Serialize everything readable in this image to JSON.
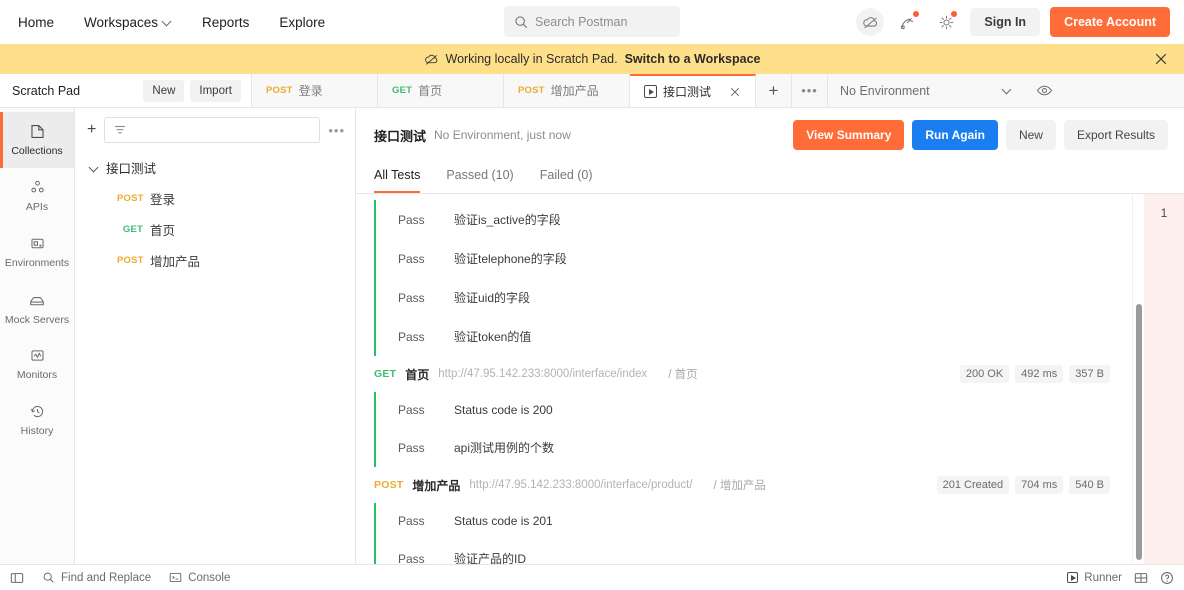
{
  "topbar": {
    "nav": [
      {
        "label": "Home",
        "icon": null
      },
      {
        "label": "Workspaces",
        "icon": "chevron-down-icon"
      },
      {
        "label": "Reports",
        "icon": null
      },
      {
        "label": "Explore",
        "icon": null
      }
    ],
    "search_placeholder": "Search Postman",
    "search_icon": "search-icon",
    "cloud_icon": "cloud-offline-icon",
    "notifications_icon": "satellite-notification-icon",
    "settings_icon": "gear-icon",
    "sign_in_label": "Sign In",
    "create_account_label": "Create Account",
    "accent": "#ff6c37"
  },
  "banner": {
    "icon": "cloud-offline-icon",
    "text": "Working locally in Scratch Pad.",
    "link": "Switch to a Workspace",
    "close_icon": "close-icon",
    "background": "#ffe08a"
  },
  "workspace": {
    "name": "Scratch Pad",
    "new_label": "New",
    "import_label": "Import"
  },
  "tabs": [
    {
      "method": "POST",
      "name": "登录",
      "active": false,
      "icon": null
    },
    {
      "method": "GET",
      "name": "首页",
      "active": false,
      "icon": null
    },
    {
      "method": "POST",
      "name": "增加产品",
      "active": false,
      "icon": null
    },
    {
      "method": null,
      "name": "接口测试",
      "active": true,
      "icon": "runner-play-icon"
    }
  ],
  "tabbar": {
    "plus_icon": "plus-icon",
    "more_icon": "ellipsis-icon",
    "environment_selected": "No Environment",
    "environment_chevron": "chevron-down-icon",
    "eye_icon": "eye-icon"
  },
  "rail": [
    {
      "label": "Collections",
      "icon": "collections-icon",
      "active": true
    },
    {
      "label": "APIs",
      "icon": "apis-icon",
      "active": false
    },
    {
      "label": "Environments",
      "icon": "environments-icon",
      "active": false
    },
    {
      "label": "Mock Servers",
      "icon": "mock-servers-icon",
      "active": false
    },
    {
      "label": "Monitors",
      "icon": "monitors-icon",
      "active": false
    },
    {
      "label": "History",
      "icon": "history-icon",
      "active": false
    }
  ],
  "sidebar": {
    "plus_icon": "plus-icon",
    "filter_icon": "filter-icon",
    "filter_placeholder": "",
    "more_icon": "ellipsis-icon",
    "collection": {
      "name": "接口测试",
      "chevron_icon": "chevron-down-icon",
      "requests": [
        {
          "method": "POST",
          "name": "登录"
        },
        {
          "method": "GET",
          "name": "首页"
        },
        {
          "method": "POST",
          "name": "增加产品"
        }
      ]
    }
  },
  "runner": {
    "title": "接口测试",
    "subtitle": "No Environment, just now",
    "buttons": {
      "view_summary": "View Summary",
      "run_again": "Run Again",
      "new": "New",
      "export_results": "Export Results"
    },
    "result_tabs": [
      {
        "label": "All Tests",
        "active": true
      },
      {
        "label": "Passed (10)",
        "active": false
      },
      {
        "label": "Failed (0)",
        "active": false
      }
    ],
    "side_badge": "1",
    "blocks": [
      {
        "request": null,
        "tests": [
          {
            "status": "Pass",
            "name": "验证is_active的字段"
          },
          {
            "status": "Pass",
            "name": "验证telephone的字段"
          },
          {
            "status": "Pass",
            "name": "验证uid的字段"
          },
          {
            "status": "Pass",
            "name": "验证token的值"
          }
        ]
      },
      {
        "request": {
          "method": "GET",
          "name": "首页",
          "url": "http://47.95.142.233:8000/interface/index",
          "path": "/ 首页",
          "status": "200 OK",
          "time": "492 ms",
          "size": "357 B"
        },
        "tests": [
          {
            "status": "Pass",
            "name": "Status code is 200"
          },
          {
            "status": "Pass",
            "name": "api测试用例的个数"
          }
        ]
      },
      {
        "request": {
          "method": "POST",
          "name": "增加产品",
          "url": "http://47.95.142.233:8000/interface/product/",
          "path": "/ 增加产品",
          "status": "201 Created",
          "time": "704 ms",
          "size": "540 B"
        },
        "tests": [
          {
            "status": "Pass",
            "name": "Status code is 201"
          },
          {
            "status": "Pass",
            "name": "验证产品的ID"
          }
        ]
      }
    ]
  },
  "footer": {
    "sidebar_toggle_icon": "sidebar-toggle-icon",
    "find_replace_label": "Find and Replace",
    "find_replace_icon": "search-icon",
    "console_label": "Console",
    "console_icon": "console-icon",
    "runner_label": "Runner",
    "runner_icon": "runner-play-icon",
    "layout_icon": "layout-grid-icon",
    "help_icon": "help-circle-icon"
  }
}
